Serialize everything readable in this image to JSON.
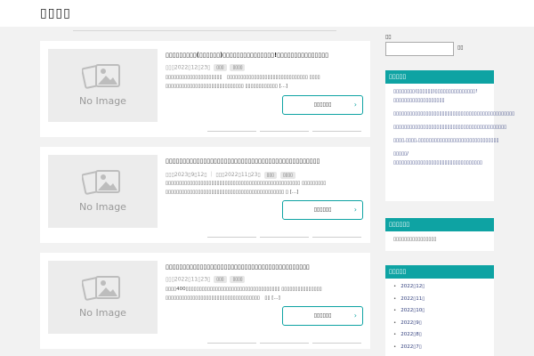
{
  "site": {
    "title": "▯▯▯▯"
  },
  "posts": [
    {
      "title": "▯▯▯▯▯▯▯▯▯(▯▯▯▯▯▯)▯▯▯▯▯▯▯▯▯▯▯▯▯▯▯!▯▯▯▯▯▯▯▯▯▯▯▯▯▯▯",
      "meta": "▯▯▯2022▯12▯23▯",
      "tags": [
        "▯▯▯",
        "▯▯▯▯"
      ],
      "excerpt_line1": "▯▯▯▯▯▯▯▯▯▯▯▯▯▯▯▯▯▯▯▯▯　▯▯▯▯▯▯▯▯▯▯▯▯▯▯▯▯▯▯▯▯▯▯▯▯▯▯▯▯▯▯ ▯▯▯▯",
      "excerpt_line2": "▯▯▯▯▯▯▯▯▯▯▯▯▯▯▯▯▯▯▯▯▯▯▯▯▯▯▯▯▯ ▯▯▯▯▯▯▯▯▯▯▯▯ [...]",
      "read_more": "▯▯▯▯▯▯"
    },
    {
      "title": "▯▯▯▯▯▯▯▯▯▯▯▯▯▯▯▯▯▯▯▯▯▯▯▯▯▯▯▯▯▯▯▯▯▯▯▯▯▯▯▯▯▯▯▯▯",
      "meta": "▯▯▯2023▯9▯12▯ ｜ ▯▯▯2022▯11▯23▯",
      "tags": [
        "▯▯▯",
        "▯▯▯▯"
      ],
      "excerpt_line1": "▯▯▯▯▯▯▯▯▯▯▯▯▯▯▯▯▯▯▯▯▯▯▯▯▯▯▯▯▯▯▯▯▯▯▯▯▯▯▯▯▯▯▯▯▯▯▯▯▯▯ ▯▯▯▯▯▯▯▯▯",
      "excerpt_line2": "▯▯▯▯▯▯▯▯▯▯▯▯▯▯▯▯▯▯▯▯▯▯▯▯▯▯▯▯▯▯▯▯▯▯▯▯▯▯▯▯▯▯▯▯ ▯ [...]",
      "read_more": "▯▯▯▯▯▯"
    },
    {
      "title": "▯▯▯▯▯▯▯▯▯▯▯▯▯▯▯▯▯▯▯▯▯▯▯▯▯▯▯▯▯▯▯▯▯▯▯▯▯▯▯▯▯▯",
      "meta": "▯▯▯2022▯11▯23▯",
      "tags": [
        "▯▯▯",
        "▯▯▯▯"
      ],
      "excerpt_line1": "▯▯▯▯400▯▯▯▯▯▯▯▯▯▯▯▯▯▯▯▯▯▯▯▯▯▯▯▯▯▯▯▯▯▯▯▯▯▯▯ ▯▯▯▯▯▯▯▯▯▯▯▯▯▯▯",
      "excerpt_line2": "▯▯▯▯▯▯▯▯▯▯▯▯▯▯▯▯▯▯▯▯▯▯▯▯▯▯▯▯▯▯▯▯▯▯▯　▯▯ [...]",
      "read_more": "▯▯▯▯▯▯"
    }
  ],
  "no_image_text": "No Image",
  "sidebar": {
    "search_label": "▯▯",
    "search_value": "",
    "search_button": "▯▯",
    "recent_title": "▯▯▯▯▯",
    "recent_items": [
      "▯▯▯▯▯▯▯▯(▯▯▯▯▯▯)▯▯▯▯▯▯▯▯▯▯▯▯▯▯▯!▯▯▯▯▯▯▯▯▯▯▯▯▯▯▯▯▯▯▯",
      "▯▯▯▯▯▯▯▯▯▯▯▯▯▯▯▯▯▯▯▯▯▯▯▯▯▯▯▯▯▯▯▯▯▯▯▯▯▯▯▯▯▯▯▯▯",
      "▯▯▯▯▯▯▯▯▯▯▯▯▯▯▯▯▯▯▯▯▯▯▯▯▯▯▯▯▯▯▯▯▯▯▯▯▯▯▯▯▯▯",
      "▯▯▯▯,▯▯▯▯,▯▯▯▯▯▯▯▯▯▯▯▯▯▯▯▯▯▯▯▯▯▯▯▯▯▯▯▯▯▯",
      "▯▯▯▯▯/▯▯▯▯▯▯▯▯▯▯▯▯▯▯▯▯▯▯▯▯▯▯▯▯▯▯▯▯▯▯▯▯▯"
    ],
    "comments_title": "▯▯▯▯▯▯",
    "comments_text": "▯▯▯▯▯▯▯▯▯▯▯▯▯▯▯▯",
    "archive_title": "▯▯▯▯▯",
    "archive_items": [
      "2022▯12▯",
      "2022▯11▯",
      "2022▯10▯",
      "2022▯9▯",
      "2022▯8▯",
      "2022▯7▯"
    ]
  },
  "colors": {
    "accent": "#0ea3a3",
    "link": "#2c3a7a",
    "bg": "#f2f2f2"
  }
}
